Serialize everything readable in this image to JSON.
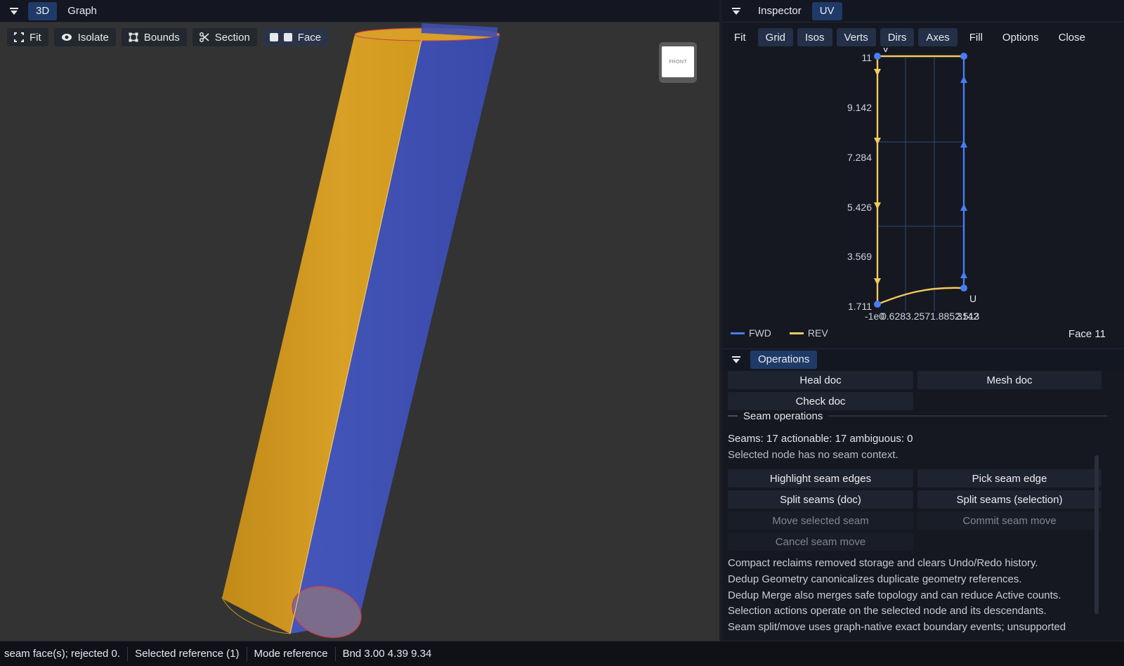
{
  "left_tabs": [
    {
      "label": "3D",
      "active": true
    },
    {
      "label": "Graph",
      "active": false
    }
  ],
  "viewport_toolbar": {
    "fit": "Fit",
    "isolate": "Isolate",
    "bounds": "Bounds",
    "section": "Section",
    "face": "Face"
  },
  "navcube": {
    "label": "FRONT"
  },
  "colors": {
    "face_a": "#d39a1f",
    "face_b": "#3e4fb2",
    "fwd": "#4a7cf5",
    "rev": "#f2c95b",
    "edge": "#d53a4a",
    "accent_tab": "#1f3a66"
  },
  "right_tabs": [
    {
      "label": "Inspector",
      "active": false
    },
    {
      "label": "UV",
      "active": true
    }
  ],
  "uv_toolbar": {
    "fit": "Fit",
    "grid": "Grid",
    "isos": "Isos",
    "verts": "Verts",
    "dirs": "Dirs",
    "axes": "Axes",
    "fill": "Fill",
    "options": "Options",
    "close": "Close"
  },
  "uv_plot": {
    "y_ticks": [
      "11",
      "9.142",
      "7.284",
      "5.426",
      "3.569",
      "1.711"
    ],
    "x_tick_text": "-1e0...",
    "x_tick_overlap": "0.6283.2571.8852.513",
    "x_tick_last": "3142",
    "v_label": "V",
    "u_label": "U"
  },
  "legend": {
    "fwd": "FWD",
    "rev": "REV"
  },
  "face_id": "Face 11",
  "operations": {
    "tab": "Operations",
    "heal_doc": "Heal doc",
    "mesh_doc": "Mesh doc",
    "check_doc": "Check doc",
    "seam_section": "Seam operations",
    "seam_stats": "Seams: 17  actionable: 17  ambiguous: 0",
    "seam_context": "Selected node has no seam context.",
    "highlight_seam_edges": "Highlight seam edges",
    "pick_seam_edge": "Pick seam edge",
    "split_seams_doc": "Split seams (doc)",
    "split_seams_selection": "Split seams (selection)",
    "move_selected_seam": "Move selected seam",
    "commit_seam_move": "Commit seam move",
    "cancel_seam_move": "Cancel seam move",
    "notes": [
      "Compact reclaims removed storage and clears Undo/Redo history.",
      "Dedup Geometry canonicalizes duplicate geometry references.",
      "Dedup Merge also merges safe topology and can reduce Active counts.",
      "Selection actions operate on the selected node and its descendants.",
      "Seam split/move uses graph-native exact boundary events; unsupported"
    ]
  },
  "status": {
    "message": "seam face(s); rejected 0.",
    "selected": "Selected reference (1)",
    "mode": "Mode reference",
    "bounds": "Bnd 3.00 4.39 9.34"
  }
}
